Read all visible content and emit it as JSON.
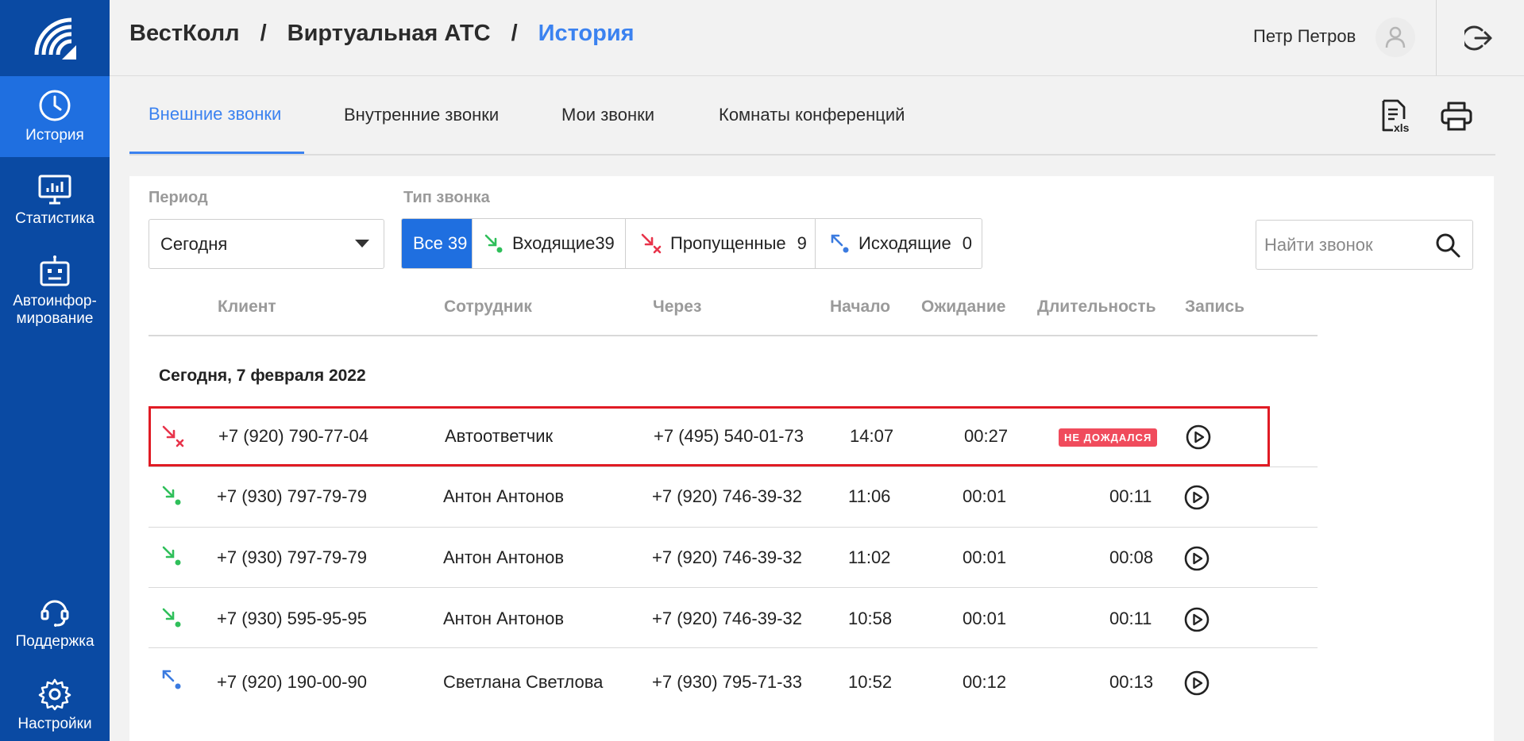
{
  "sidebar": {
    "items": [
      {
        "label": "История",
        "icon": "clock-icon"
      },
      {
        "label": "Статистика",
        "icon": "monitor-chart-icon"
      },
      {
        "label_line1": "Автоинфор-",
        "label_line2": "мирование",
        "icon": "robot-icon"
      },
      {
        "label": "Поддержка",
        "icon": "headset-icon"
      },
      {
        "label": "Настройки",
        "icon": "gear-icon"
      }
    ]
  },
  "header": {
    "breadcrumb": [
      "ВестКолл",
      "Виртуальная АТС",
      "История"
    ],
    "separator": "/",
    "user_name": "Петр Петров"
  },
  "tabs": [
    "Внешние звонки",
    "Внутренние звонки",
    "Мои звонки",
    "Комнаты конференций"
  ],
  "tools": {
    "xls_label": "xls"
  },
  "filters": {
    "period_label": "Период",
    "period_value": "Сегодня",
    "type_label": "Тип звонка",
    "types": [
      {
        "label": "Все",
        "count": "39"
      },
      {
        "label": "Входящие",
        "count": "39"
      },
      {
        "label": "Пропущенные",
        "count": "9"
      },
      {
        "label": "Исходящие",
        "count": "0"
      }
    ],
    "search_placeholder": "Найти звонок"
  },
  "table": {
    "columns": [
      "Клиент",
      "Сотрудник",
      "Через",
      "Начало",
      "Ожидание",
      "Длительность",
      "Запись"
    ],
    "group_title": "Сегодня, 7 февраля 2022",
    "rows": [
      {
        "type": "missed",
        "client": "+7 (920) 790-77-04",
        "employee": "Автоответчик",
        "via": "+7 (495) 540-01-73",
        "start": "14:07",
        "wait": "00:27",
        "duration": "",
        "badge": "НЕ ДОЖДАЛСЯ"
      },
      {
        "type": "incoming",
        "client": "+7 (930) 797-79-79",
        "employee": "Антон Антонов",
        "via": "+7 (920) 746-39-32",
        "start": "11:06",
        "wait": "00:01",
        "duration": "00:11",
        "badge": ""
      },
      {
        "type": "incoming",
        "client": "+7 (930) 797-79-79",
        "employee": "Антон Антонов",
        "via": "+7 (920) 746-39-32",
        "start": "11:02",
        "wait": "00:01",
        "duration": "00:08",
        "badge": ""
      },
      {
        "type": "incoming",
        "client": "+7 (930) 595-95-95",
        "employee": "Антон Антонов",
        "via": "+7 (920) 746-39-32",
        "start": "10:58",
        "wait": "00:01",
        "duration": "00:11",
        "badge": ""
      },
      {
        "type": "outgoing",
        "client": "+7 (920) 190-00-90",
        "employee": "Светлана Светлова",
        "via": "+7 (930) 795-71-33",
        "start": "10:52",
        "wait": "00:12",
        "duration": "00:13",
        "badge": ""
      }
    ]
  },
  "colors": {
    "primary": "#0a4aa3",
    "accent": "#1f6fe0",
    "link": "#3b82f0",
    "missed": "#e8334a",
    "incoming": "#2fbf5a",
    "outgoing": "#3b7be0"
  }
}
